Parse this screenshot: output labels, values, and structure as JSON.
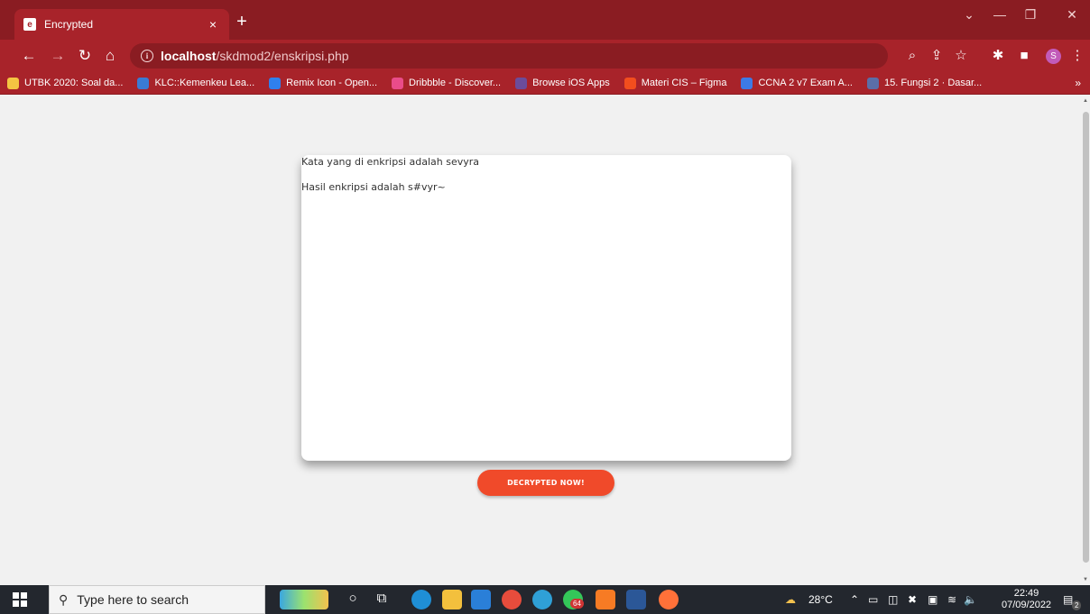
{
  "tab": {
    "title": "Encrypted",
    "close_label": "×"
  },
  "newtab_label": "+",
  "address": {
    "host": "localhost",
    "path": "/skdmod2/enskripsi.php"
  },
  "bookmarks": [
    {
      "label": "UTBK 2020: Soal da...",
      "color": "#f4c542"
    },
    {
      "label": "KLC::Kemenkeu Lea...",
      "color": "#3a7bd5"
    },
    {
      "label": "Remix Icon - Open...",
      "color": "#2f80ed"
    },
    {
      "label": "Dribbble - Discover...",
      "color": "#ea4c89"
    },
    {
      "label": "Browse iOS Apps",
      "color": "#6b4c9a"
    },
    {
      "label": "Materi CIS – Figma",
      "color": "#f24e1e"
    },
    {
      "label": "CCNA 2 v7 Exam A...",
      "color": "#3d7ae6"
    },
    {
      "label": "15. Fungsi 2 · Dasar...",
      "color": "#5b6ea8"
    }
  ],
  "bookmarks_more": "»",
  "profile_initial": "S",
  "page": {
    "line1": "Kata yang di enkripsi adalah sevyra",
    "line2": "Hasil enkripsi adalah s#vyr~",
    "button_label": "DECRYPTED NOW!"
  },
  "taskbar": {
    "search_placeholder": "Type here to search",
    "weather": "28°C",
    "time": "22:49",
    "date": "07/09/2022",
    "whatsapp_badge": "64",
    "notification_count": "2"
  },
  "colors": {
    "browser_frame": "#a8232a",
    "tab_strip": "#8a1c22",
    "accent_button": "#f04a2a",
    "taskbar": "#23272e"
  }
}
